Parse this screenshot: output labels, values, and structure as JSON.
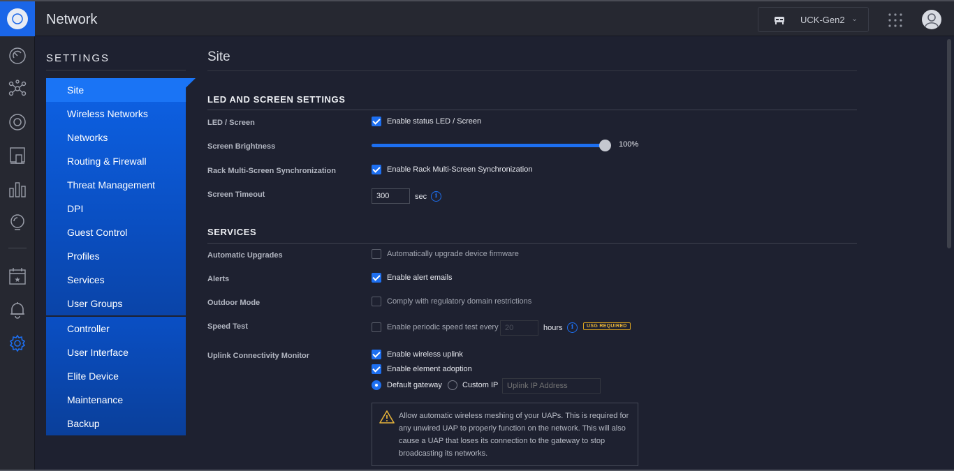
{
  "app": {
    "title": "Network"
  },
  "topbar": {
    "device_name": "UCK-Gen2",
    "device_icon": "cloud-key-icon",
    "apps_icon": "grid-icon",
    "avatar_icon": "user-icon"
  },
  "rail": {
    "icons": [
      "dashboard-icon",
      "topology-icon",
      "statistics-icon",
      "devices-icon",
      "insights-icon",
      "alerts-bulb-icon",
      "events-calendar-icon",
      "notifications-bell-icon",
      "settings-gear-icon"
    ],
    "active": "settings-gear-icon"
  },
  "sidebar": {
    "heading": "SETTINGS",
    "items": [
      {
        "label": "Site"
      },
      {
        "label": "Wireless Networks"
      },
      {
        "label": "Networks"
      },
      {
        "label": "Routing & Firewall"
      },
      {
        "label": "Threat Management"
      },
      {
        "label": "DPI"
      },
      {
        "label": "Guest Control"
      },
      {
        "label": "Profiles"
      },
      {
        "label": "Services"
      },
      {
        "label": "User Groups"
      }
    ],
    "items2": [
      {
        "label": "Controller"
      },
      {
        "label": "User Interface"
      },
      {
        "label": "Elite Device"
      },
      {
        "label": "Maintenance"
      },
      {
        "label": "Backup"
      }
    ],
    "active": "Site"
  },
  "main": {
    "title": "Site",
    "led_section": {
      "title": "LED AND SCREEN SETTINGS",
      "led_label": "LED / Screen",
      "led_checkbox": "Enable status LED / Screen",
      "led_checked": true,
      "brightness_label": "Screen Brightness",
      "brightness_value": 100,
      "brightness_text": "100%",
      "rack_label": "Rack Multi-Screen Synchronization",
      "rack_checkbox": "Enable Rack Multi-Screen Synchronization",
      "rack_checked": true,
      "timeout_label": "Screen Timeout",
      "timeout_value": "300",
      "timeout_unit": "sec"
    },
    "services_section": {
      "title": "SERVICES",
      "auto_upgrade_label": "Automatic Upgrades",
      "auto_upgrade_checkbox": "Automatically upgrade device firmware",
      "auto_upgrade_checked": false,
      "alerts_label": "Alerts",
      "alerts_checkbox": "Enable alert emails",
      "alerts_checked": true,
      "outdoor_label": "Outdoor Mode",
      "outdoor_checkbox": "Comply with regulatory domain restrictions",
      "outdoor_checked": false,
      "speed_label": "Speed Test",
      "speed_checkbox": "Enable periodic speed test every",
      "speed_checked": false,
      "speed_interval": "20",
      "speed_unit": "hours",
      "usg_badge": "USG REQUIRED",
      "uplink_label": "Uplink Connectivity Monitor",
      "wireless_uplink_checkbox": "Enable wireless uplink",
      "wireless_uplink_checked": true,
      "element_adoption_checkbox": "Enable element adoption",
      "element_adoption_checked": true,
      "default_gateway_radio": "Default gateway",
      "custom_ip_radio": "Custom IP",
      "selected_radio": "Default gateway",
      "uplink_ip_placeholder": "Uplink IP Address",
      "warning_text": "Allow automatic wireless meshing of your UAPs. This is required for any unwired UAP to properly function on the network. This will also cause a UAP that loses its connection to the gateway to stop broadcasting its networks."
    }
  },
  "colors": {
    "accent": "#1d6ff0",
    "nav_blue": "#0d5fe0",
    "warning": "#e3b13a",
    "background": "#1e2130",
    "topbar": "#262831"
  }
}
